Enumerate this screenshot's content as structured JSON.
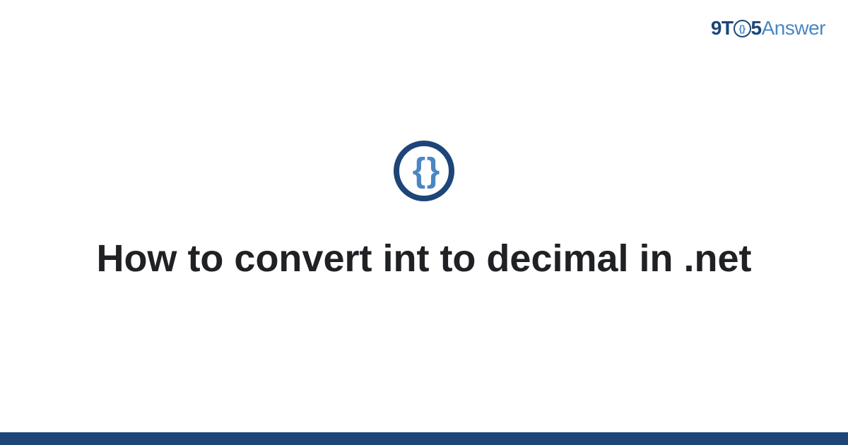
{
  "header": {
    "logo": {
      "part1": "9T",
      "badge_text": "{}",
      "part2": "5",
      "part3": "Answer"
    }
  },
  "main": {
    "icon_glyph": "{ }",
    "title": "How to convert int to decimal in .net"
  }
}
